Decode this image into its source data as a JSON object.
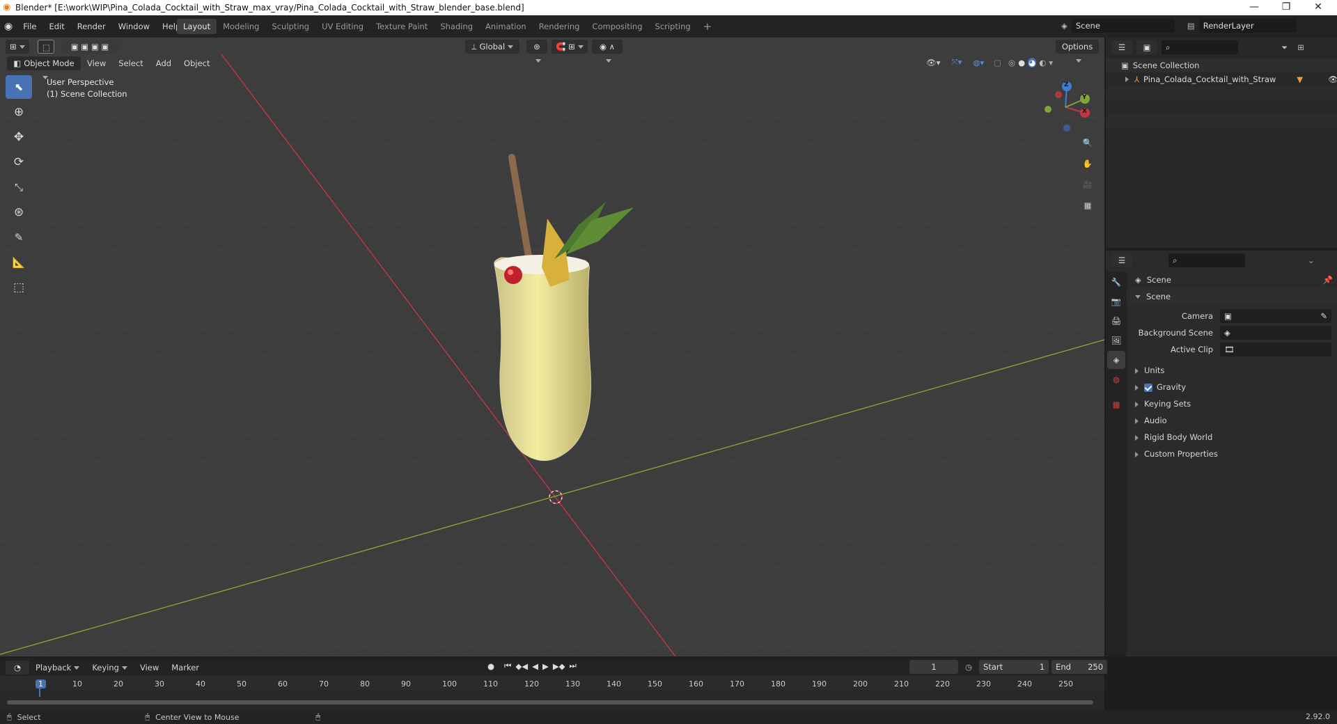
{
  "window": {
    "title": "Blender* [E:\\work\\WIP\\Pina_Colada_Cocktail_with_Straw_max_vray/Pina_Colada_Cocktail_with_Straw_blender_base.blend]",
    "minimize": "—",
    "maximize": "❐",
    "close": "✕"
  },
  "menubar": {
    "menus": [
      "File",
      "Edit",
      "Render",
      "Window",
      "Help"
    ],
    "workspaces": [
      "Layout",
      "Modeling",
      "Sculpting",
      "UV Editing",
      "Texture Paint",
      "Shading",
      "Animation",
      "Rendering",
      "Compositing",
      "Scripting"
    ],
    "active_workspace": "Layout",
    "add_workspace": "+",
    "scene_name": "Scene",
    "view_layer": "RenderLayer"
  },
  "viewport": {
    "transform_orientation": "Global",
    "options_label": "Options",
    "mode": "Object Mode",
    "menus": [
      "View",
      "Select",
      "Add",
      "Object"
    ],
    "overlay_line1": "User Perspective",
    "overlay_line2": "(1) Scene Collection",
    "gizmo": {
      "x": "X",
      "y": "Y",
      "z": "Z"
    }
  },
  "outliner": {
    "root": "Scene Collection",
    "items": [
      {
        "label": "Pina_Colada_Cocktail_with_Straw"
      }
    ]
  },
  "properties": {
    "header": "Scene",
    "panel_title": "Scene",
    "fields": [
      {
        "label": "Camera",
        "value": ""
      },
      {
        "label": "Background Scene",
        "value": ""
      },
      {
        "label": "Active Clip",
        "value": ""
      }
    ],
    "subpanels": [
      "Units",
      "Gravity",
      "Keying Sets",
      "Audio",
      "Rigid Body World",
      "Custom Properties"
    ],
    "gravity_checked": true
  },
  "timeline": {
    "menus": [
      "Playback",
      "Keying",
      "View",
      "Marker"
    ],
    "current_frame": "1",
    "start_label": "Start",
    "start_value": "1",
    "end_label": "End",
    "end_value": "250",
    "ruler": [
      "1",
      "10",
      "20",
      "30",
      "40",
      "50",
      "60",
      "70",
      "80",
      "90",
      "100",
      "110",
      "120",
      "130",
      "140",
      "150",
      "160",
      "170",
      "180",
      "190",
      "200",
      "210",
      "220",
      "230",
      "240",
      "250"
    ]
  },
  "statusbar": {
    "select": "Select",
    "center_view": "Center View to Mouse",
    "version": "2.92.0"
  },
  "colors": {
    "accent": "#4772b3",
    "x_axis": "#c1383f",
    "y_axis": "#7ea63b",
    "z_axis": "#3d7fd4"
  }
}
